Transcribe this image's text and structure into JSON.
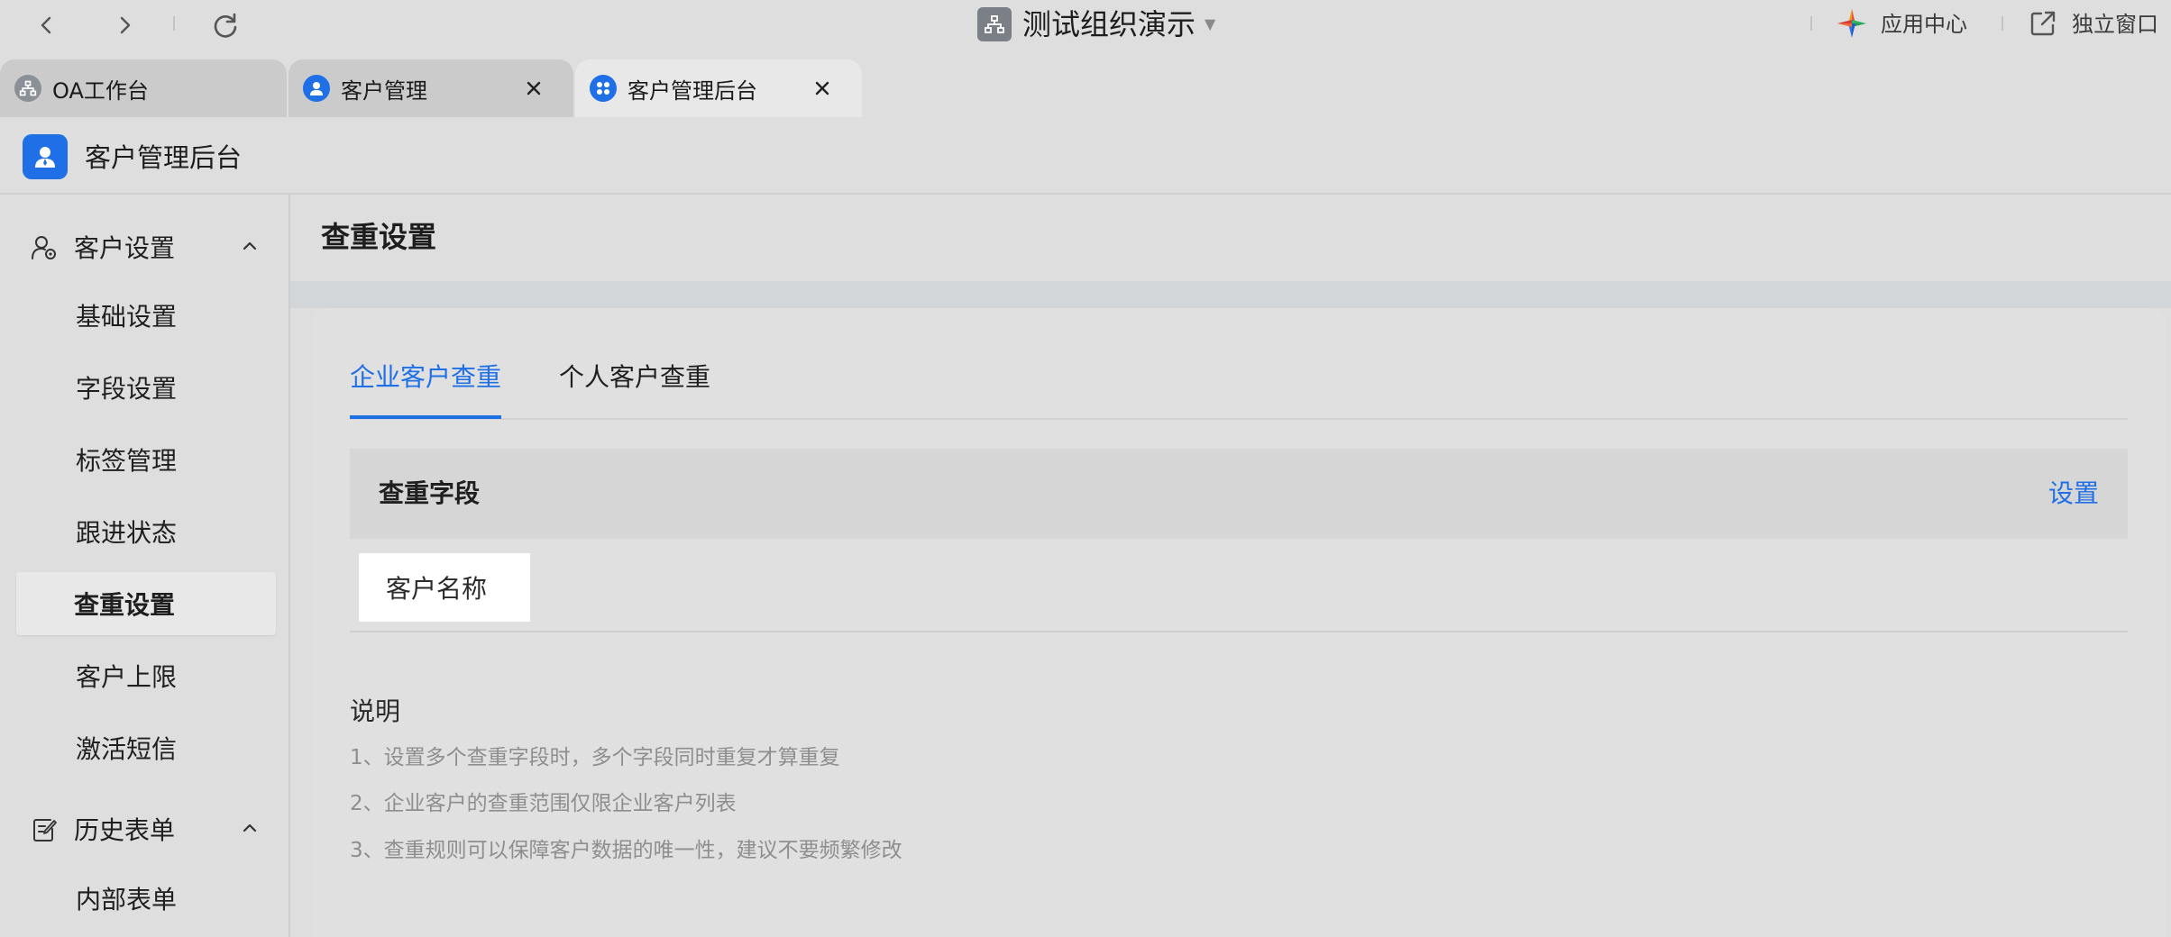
{
  "topbar": {
    "org_name": "测试组织演示",
    "app_center": "应用中心",
    "standalone_window": "独立窗口"
  },
  "tabs": [
    {
      "label": "OA工作台",
      "icon": "org-icon",
      "active": false,
      "closable": false
    },
    {
      "label": "客户管理",
      "icon": "user-icon",
      "active": false,
      "closable": true
    },
    {
      "label": "客户管理后台",
      "icon": "grid-icon",
      "active": true,
      "closable": true
    }
  ],
  "app": {
    "title": "客户管理后台"
  },
  "sidebar": {
    "groups": [
      {
        "label": "客户设置",
        "icon": "customer-settings-icon",
        "expanded": true,
        "items": [
          "基础设置",
          "字段设置",
          "标签管理",
          "跟进状态",
          "查重设置",
          "客户上限",
          "激活短信"
        ]
      },
      {
        "label": "历史表单",
        "icon": "form-edit-icon",
        "expanded": true,
        "items": [
          "内部表单"
        ]
      }
    ],
    "active_item": "查重设置"
  },
  "main": {
    "title": "查重设置",
    "subtabs": [
      "企业客户查重",
      "个人客户查重"
    ],
    "active_subtab": "企业客户查重",
    "field_header": "查重字段",
    "settings_link": "设置",
    "fields": [
      "客户名称"
    ],
    "notes_title": "说明",
    "notes": [
      "1、设置多个查重字段时，多个字段同时重复才算重复",
      "2、企业客户的查重范围仅限企业客户列表",
      "3、查重规则可以保障客户数据的唯一性，建议不要频繁修改"
    ]
  },
  "colors": {
    "accent": "#1f6fe6",
    "background": "#dedede",
    "muted_text": "#8e8e8e"
  }
}
